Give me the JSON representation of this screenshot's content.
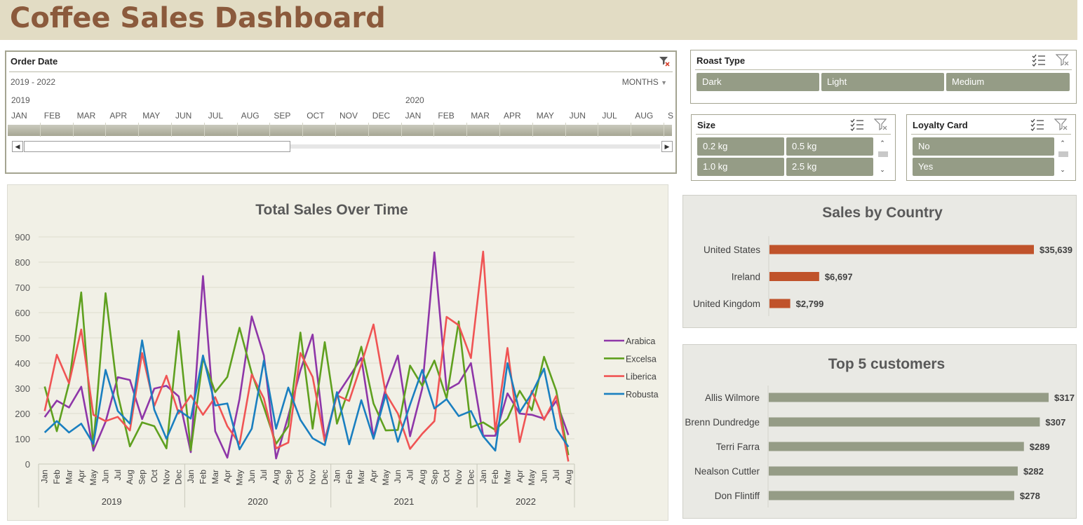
{
  "header": {
    "title": "Coffee Sales Dashboard"
  },
  "timeline": {
    "title": "Order Date",
    "range": "2019 - 2022",
    "level": "MONTHS",
    "years": [
      "2019",
      "2020"
    ],
    "months": [
      "JAN",
      "FEB",
      "MAR",
      "APR",
      "MAY",
      "JUN",
      "JUL",
      "AUG",
      "SEP",
      "OCT",
      "NOV",
      "DEC",
      "JAN",
      "FEB",
      "MAR",
      "APR",
      "MAY",
      "JUN",
      "JUL",
      "AUG",
      "S"
    ]
  },
  "slicers": {
    "roast": {
      "title": "Roast Type",
      "items": [
        "Dark",
        "Light",
        "Medium"
      ]
    },
    "size": {
      "title": "Size",
      "items": [
        "0.2 kg",
        "0.5 kg",
        "1.0 kg",
        "2.5 kg"
      ]
    },
    "loyalty": {
      "title": "Loyalty Card",
      "items": [
        "No",
        "Yes"
      ]
    }
  },
  "colors": {
    "Arabica": "#8e36a8",
    "Excelsa": "#5fa01f",
    "Liberica": "#f05454",
    "Robusta": "#1a7fc0",
    "country_bar": "#c0532b",
    "customer_bar": "#959c86",
    "line_panel_bg": "#f1f0e6",
    "side_panel_bg": "#e9e9e4"
  },
  "chart_data": [
    {
      "type": "line",
      "title": "Total Sales Over Time",
      "ylim": [
        0,
        900
      ],
      "yticks": [
        0,
        100,
        200,
        300,
        400,
        500,
        600,
        700,
        800,
        900
      ],
      "grid": true,
      "legend": "right",
      "categories": [
        "Jan",
        "Feb",
        "Mar",
        "Apr",
        "May",
        "Jun",
        "Jul",
        "Aug",
        "Sep",
        "Oct",
        "Nov",
        "Dec",
        "Jan",
        "Feb",
        "Mar",
        "Apr",
        "May",
        "Jun",
        "Jul",
        "Aug",
        "Sep",
        "Oct",
        "Nov",
        "Dec",
        "Jan",
        "Feb",
        "Mar",
        "Apr",
        "May",
        "Jun",
        "Jul",
        "Aug",
        "Sep",
        "Oct",
        "Nov",
        "Dec",
        "Jan",
        "Feb",
        "Mar",
        "Apr",
        "May",
        "Jun",
        "Jul",
        "Aug"
      ],
      "groups": [
        {
          "label": "2019",
          "count": 12
        },
        {
          "label": "2020",
          "count": 12
        },
        {
          "label": "2021",
          "count": 12
        },
        {
          "label": "2022",
          "count": 8
        }
      ],
      "series": [
        {
          "name": "Arabica",
          "values": [
            186,
            251,
            224,
            306,
            53,
            167,
            344,
            333,
            178,
            299,
            310,
            268,
            47,
            745,
            130,
            25,
            258,
            585,
            430,
            22,
            190,
            371,
            513,
            96,
            272,
            345,
            420,
            105,
            300,
            430,
            110,
            300,
            839,
            293,
            320,
            400,
            112,
            112,
            280,
            200,
            195,
            180,
            250,
            115
          ]
        },
        {
          "name": "Excelsa",
          "values": [
            307,
            130,
            320,
            680,
            70,
            677,
            276,
            70,
            165,
            150,
            62,
            527,
            55,
            420,
            285,
            345,
            540,
            360,
            225,
            80,
            150,
            521,
            140,
            483,
            160,
            300,
            465,
            240,
            133,
            135,
            390,
            310,
            410,
            260,
            565,
            145,
            165,
            135,
            180,
            290,
            213,
            425,
            290,
            35
          ]
        },
        {
          "name": "Liberica",
          "values": [
            210,
            433,
            320,
            533,
            195,
            170,
            187,
            133,
            440,
            230,
            350,
            200,
            272,
            195,
            265,
            150,
            80,
            355,
            260,
            62,
            85,
            440,
            345,
            90,
            272,
            250,
            395,
            553,
            280,
            200,
            60,
            120,
            170,
            583,
            550,
            420,
            842,
            128,
            460,
            87,
            290,
            175,
            270,
            10
          ]
        },
        {
          "name": "Robusta",
          "values": [
            125,
            170,
            125,
            160,
            80,
            373,
            210,
            160,
            490,
            215,
            100,
            213,
            180,
            430,
            232,
            240,
            58,
            140,
            410,
            140,
            303,
            175,
            102,
            75,
            285,
            78,
            253,
            100,
            275,
            88,
            235,
            373,
            220,
            257,
            190,
            210,
            110,
            53,
            400,
            205,
            280,
            378,
            140,
            68
          ]
        }
      ]
    },
    {
      "type": "bar",
      "title": "Sales by Country",
      "categories": [
        "United States",
        "Ireland",
        "United Kingdom"
      ],
      "values": [
        35639,
        6697,
        2799
      ],
      "labels": [
        "$35,639",
        "$6,697",
        "$2,799"
      ]
    },
    {
      "type": "bar",
      "title": "Top 5 customers",
      "categories": [
        "Allis Wilmore",
        "Brenn Dundredge",
        "Terri Farra",
        "Nealson Cuttler",
        "Don Flintiff"
      ],
      "values": [
        317,
        307,
        289,
        282,
        278
      ],
      "labels": [
        "$317",
        "$307",
        "$289",
        "$282",
        "$278"
      ]
    }
  ]
}
